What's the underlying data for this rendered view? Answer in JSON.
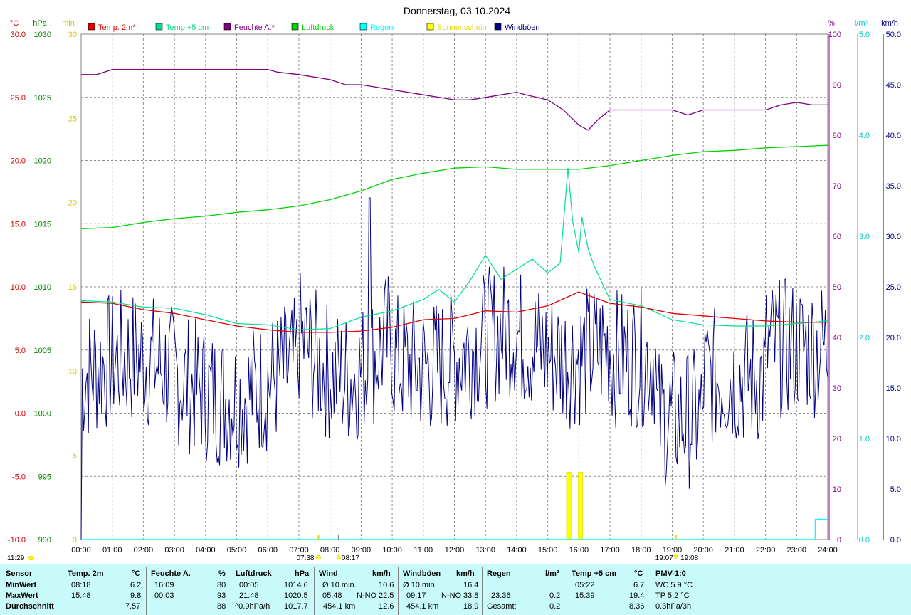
{
  "title": "Donnerstag, 03.10.2024",
  "units": {
    "temp": "°C",
    "pressure": "hPa",
    "min": "min",
    "humidity": "%",
    "rain": "l/m²",
    "wind": "km/h"
  },
  "legend": [
    {
      "label": "Temp. 2m*",
      "color": "#e00000"
    },
    {
      "label": "Temp +5 cm",
      "color": "#00e08c"
    },
    {
      "label": "Feuchte A.*",
      "color": "#800080"
    },
    {
      "label": "Luftdruck",
      "color": "#00d000"
    },
    {
      "label": "Regen",
      "color": "#00ffff"
    },
    {
      "label": "Sonnenschein",
      "color": "#ffff00"
    },
    {
      "label": "Windböen",
      "color": "#000080"
    }
  ],
  "chart_data": {
    "type": "line",
    "title": "Donnerstag, 03.10.2024",
    "x_ticks": [
      "00:00",
      "01:00",
      "02:00",
      "03:00",
      "04:00",
      "05:00",
      "06:00",
      "07:00",
      "08:00",
      "09:00",
      "10:00",
      "11:00",
      "12:00",
      "13:00",
      "14:00",
      "15:00",
      "16:00",
      "17:00",
      "18:00",
      "19:00",
      "20:00",
      "21:00",
      "22:00",
      "23:00",
      "24:00"
    ],
    "axes": {
      "temp_c": {
        "range": [
          -10,
          30
        ],
        "ticks": [
          "30.0",
          "25.0",
          "20.0",
          "15.0",
          "10.0",
          "5.0",
          "0.0",
          "-5.0",
          "-10.0"
        ]
      },
      "pressure_hpa": {
        "range": [
          990,
          1030
        ],
        "ticks": [
          "1030",
          "1025",
          "1020",
          "1015",
          "1010",
          "1005",
          "1000",
          "995",
          "990"
        ]
      },
      "sun_min": {
        "range": [
          0,
          30
        ],
        "ticks": [
          "30",
          "25",
          "20",
          "15",
          "10",
          "5",
          "0"
        ]
      },
      "humidity_pct": {
        "range": [
          0,
          100
        ],
        "ticks": [
          "100",
          "90",
          "80",
          "70",
          "60",
          "50",
          "40",
          "30",
          "20",
          "10",
          "0"
        ]
      },
      "rain_lm2": {
        "range": [
          0,
          5
        ],
        "ticks": [
          "5.0",
          "4.0",
          "3.0",
          "2.0",
          "1.0",
          "0.0"
        ]
      },
      "wind_kmh": {
        "range": [
          0,
          50
        ],
        "ticks": [
          "50.0",
          "45.0",
          "40.0",
          "35.0",
          "30.0",
          "25.0",
          "20.0",
          "15.0",
          "10.0",
          "5.0",
          "0.0"
        ]
      }
    },
    "series": [
      {
        "name": "Temp. 2m*",
        "axis": "temp_c",
        "x": [
          0,
          1,
          2,
          3,
          4,
          5,
          6,
          7,
          8,
          9,
          10,
          11,
          12,
          13,
          14,
          15,
          16,
          17,
          18,
          19,
          20,
          21,
          22,
          23,
          24
        ],
        "values": [
          8.8,
          8.7,
          8.2,
          7.9,
          7.4,
          6.9,
          6.6,
          6.4,
          6.4,
          6.5,
          6.8,
          7.4,
          7.5,
          8.1,
          8.0,
          8.5,
          9.6,
          8.7,
          8.4,
          7.9,
          7.7,
          7.5,
          7.3,
          7.2,
          7.2
        ]
      },
      {
        "name": "Temp +5 cm",
        "axis": "temp_c",
        "x": [
          0,
          1,
          2,
          3,
          4,
          5,
          6,
          7,
          8,
          9,
          10,
          11,
          11.5,
          12,
          12.5,
          13,
          13.5,
          14,
          14.5,
          15,
          15.4,
          15.65,
          15.8,
          16,
          16.1,
          16.3,
          16.5,
          17,
          18,
          19,
          20,
          21,
          22,
          23,
          24
        ],
        "values": [
          8.9,
          8.8,
          8.4,
          8.3,
          7.8,
          7.1,
          7.0,
          6.6,
          6.7,
          7.6,
          8.1,
          9.0,
          9.8,
          8.8,
          10.5,
          12.5,
          10.6,
          11.4,
          12.2,
          11.1,
          11.9,
          19.4,
          15.2,
          12.7,
          15.5,
          13.0,
          11.6,
          9.0,
          8.5,
          7.4,
          7.0,
          6.9,
          6.9,
          7.1,
          7.3
        ]
      },
      {
        "name": "Feuchte A.*",
        "axis": "humidity_pct",
        "x": [
          0,
          0.5,
          1,
          2,
          3,
          4,
          5,
          6,
          6.3,
          7,
          8,
          8.5,
          9,
          10,
          11,
          12,
          12.5,
          13,
          13.5,
          14,
          14.3,
          15,
          15.5,
          16,
          16.3,
          16.6,
          17,
          18,
          19,
          19.5,
          20,
          21,
          22,
          22.5,
          23,
          23.5,
          24
        ],
        "values": [
          92,
          92,
          93,
          93,
          93,
          93,
          93,
          93,
          92.5,
          92,
          91,
          90,
          90,
          89,
          88,
          87,
          87,
          87.5,
          88,
          88.5,
          88,
          87,
          85,
          82,
          81,
          83,
          85,
          85,
          85,
          84,
          85,
          85,
          85,
          86,
          86.5,
          86,
          86
        ]
      },
      {
        "name": "Luftdruck",
        "axis": "pressure_hpa",
        "x": [
          0,
          1,
          2,
          3,
          4,
          5,
          6,
          7,
          8,
          9,
          10,
          11,
          12,
          13,
          14,
          15,
          16,
          17,
          18,
          19,
          20,
          21,
          22,
          23,
          24
        ],
        "values": [
          1014.6,
          1014.7,
          1015.1,
          1015.4,
          1015.6,
          1015.9,
          1016.1,
          1016.4,
          1016.9,
          1017.6,
          1018.5,
          1019.0,
          1019.4,
          1019.5,
          1019.3,
          1019.3,
          1019.3,
          1019.6,
          1020.0,
          1020.4,
          1020.7,
          1020.8,
          1021.0,
          1021.1,
          1021.2
        ]
      },
      {
        "name": "Regen",
        "axis": "rain_lm2",
        "x": [
          0,
          23.5,
          23.6,
          24
        ],
        "values": [
          0,
          0,
          0.2,
          0.2
        ]
      },
      {
        "name": "Windböen",
        "axis": "wind_kmh",
        "type": "gusts",
        "mean": 18.9,
        "max": 33.8,
        "max_time": "09:17"
      }
    ],
    "sunshine_bars": [
      {
        "start": 15.6,
        "end": 15.75,
        "minutes": 4
      },
      {
        "start": 15.98,
        "end": 16.12,
        "minutes": 4
      }
    ],
    "sun_events": {
      "sunrise": "07:38",
      "sunrise_x": 7.63,
      "noon": "08:17",
      "noon_x": 8.28,
      "sunset": "19:07",
      "sunset_x": 19.12,
      "moon": "19:08",
      "moon_x": 19.13,
      "bottom_left": "11:29"
    }
  },
  "stats": {
    "sensor": {
      "header": "Sensor",
      "rows": [
        "MinWert",
        "MaxWert",
        "Durchschnitt"
      ]
    },
    "temp2m": {
      "header": "Temp. 2m",
      "unit": "°C",
      "rows": [
        [
          "08:18",
          "6.2"
        ],
        [
          "15:48",
          "9.8"
        ],
        [
          "",
          "7.57"
        ]
      ]
    },
    "humidity": {
      "header": "Feuchte A.",
      "unit": "%",
      "rows": [
        [
          "16:09",
          "80"
        ],
        [
          "00:03",
          "93"
        ],
        [
          "",
          "88"
        ]
      ]
    },
    "pressure": {
      "header": "Luftdruck",
      "unit": "hPa",
      "rows": [
        [
          "00:05",
          "1014.6"
        ],
        [
          "21:48",
          "1020.5"
        ],
        [
          "^0.9hPa/h",
          "1017.7"
        ]
      ]
    },
    "wind": {
      "header": "Wind",
      "unit": "km/h",
      "rows": [
        [
          "Ø 10 min.",
          "",
          "10.6"
        ],
        [
          "05:48",
          "N-NO",
          "22.5"
        ],
        [
          "454.1 km",
          "",
          "12.6"
        ]
      ]
    },
    "gusts": {
      "header": "Windböen",
      "unit": "km/h",
      "rows": [
        [
          "Ø 10 min.",
          "",
          "16.4"
        ],
        [
          "09:17",
          "N-NO",
          "33.8"
        ],
        [
          "454.1 km",
          "",
          "18.9"
        ]
      ]
    },
    "rain": {
      "header": "Regen",
      "unit": "l/m²",
      "rows": [
        [
          "",
          ""
        ],
        [
          "23:36",
          "0.2"
        ],
        [
          "Gesamt:",
          "0.2"
        ]
      ]
    },
    "temp5cm": {
      "header": "Temp +5 cm",
      "unit": "°C",
      "rows": [
        [
          "05:22",
          "6.7"
        ],
        [
          "15:39",
          "19.4"
        ],
        [
          "",
          "8.36"
        ]
      ]
    },
    "pmv": {
      "header": "PMV-1:0",
      "rows": [
        "WC 5.9 °C",
        "TP 5.2 °C",
        "0.3hPa/3h"
      ]
    }
  }
}
